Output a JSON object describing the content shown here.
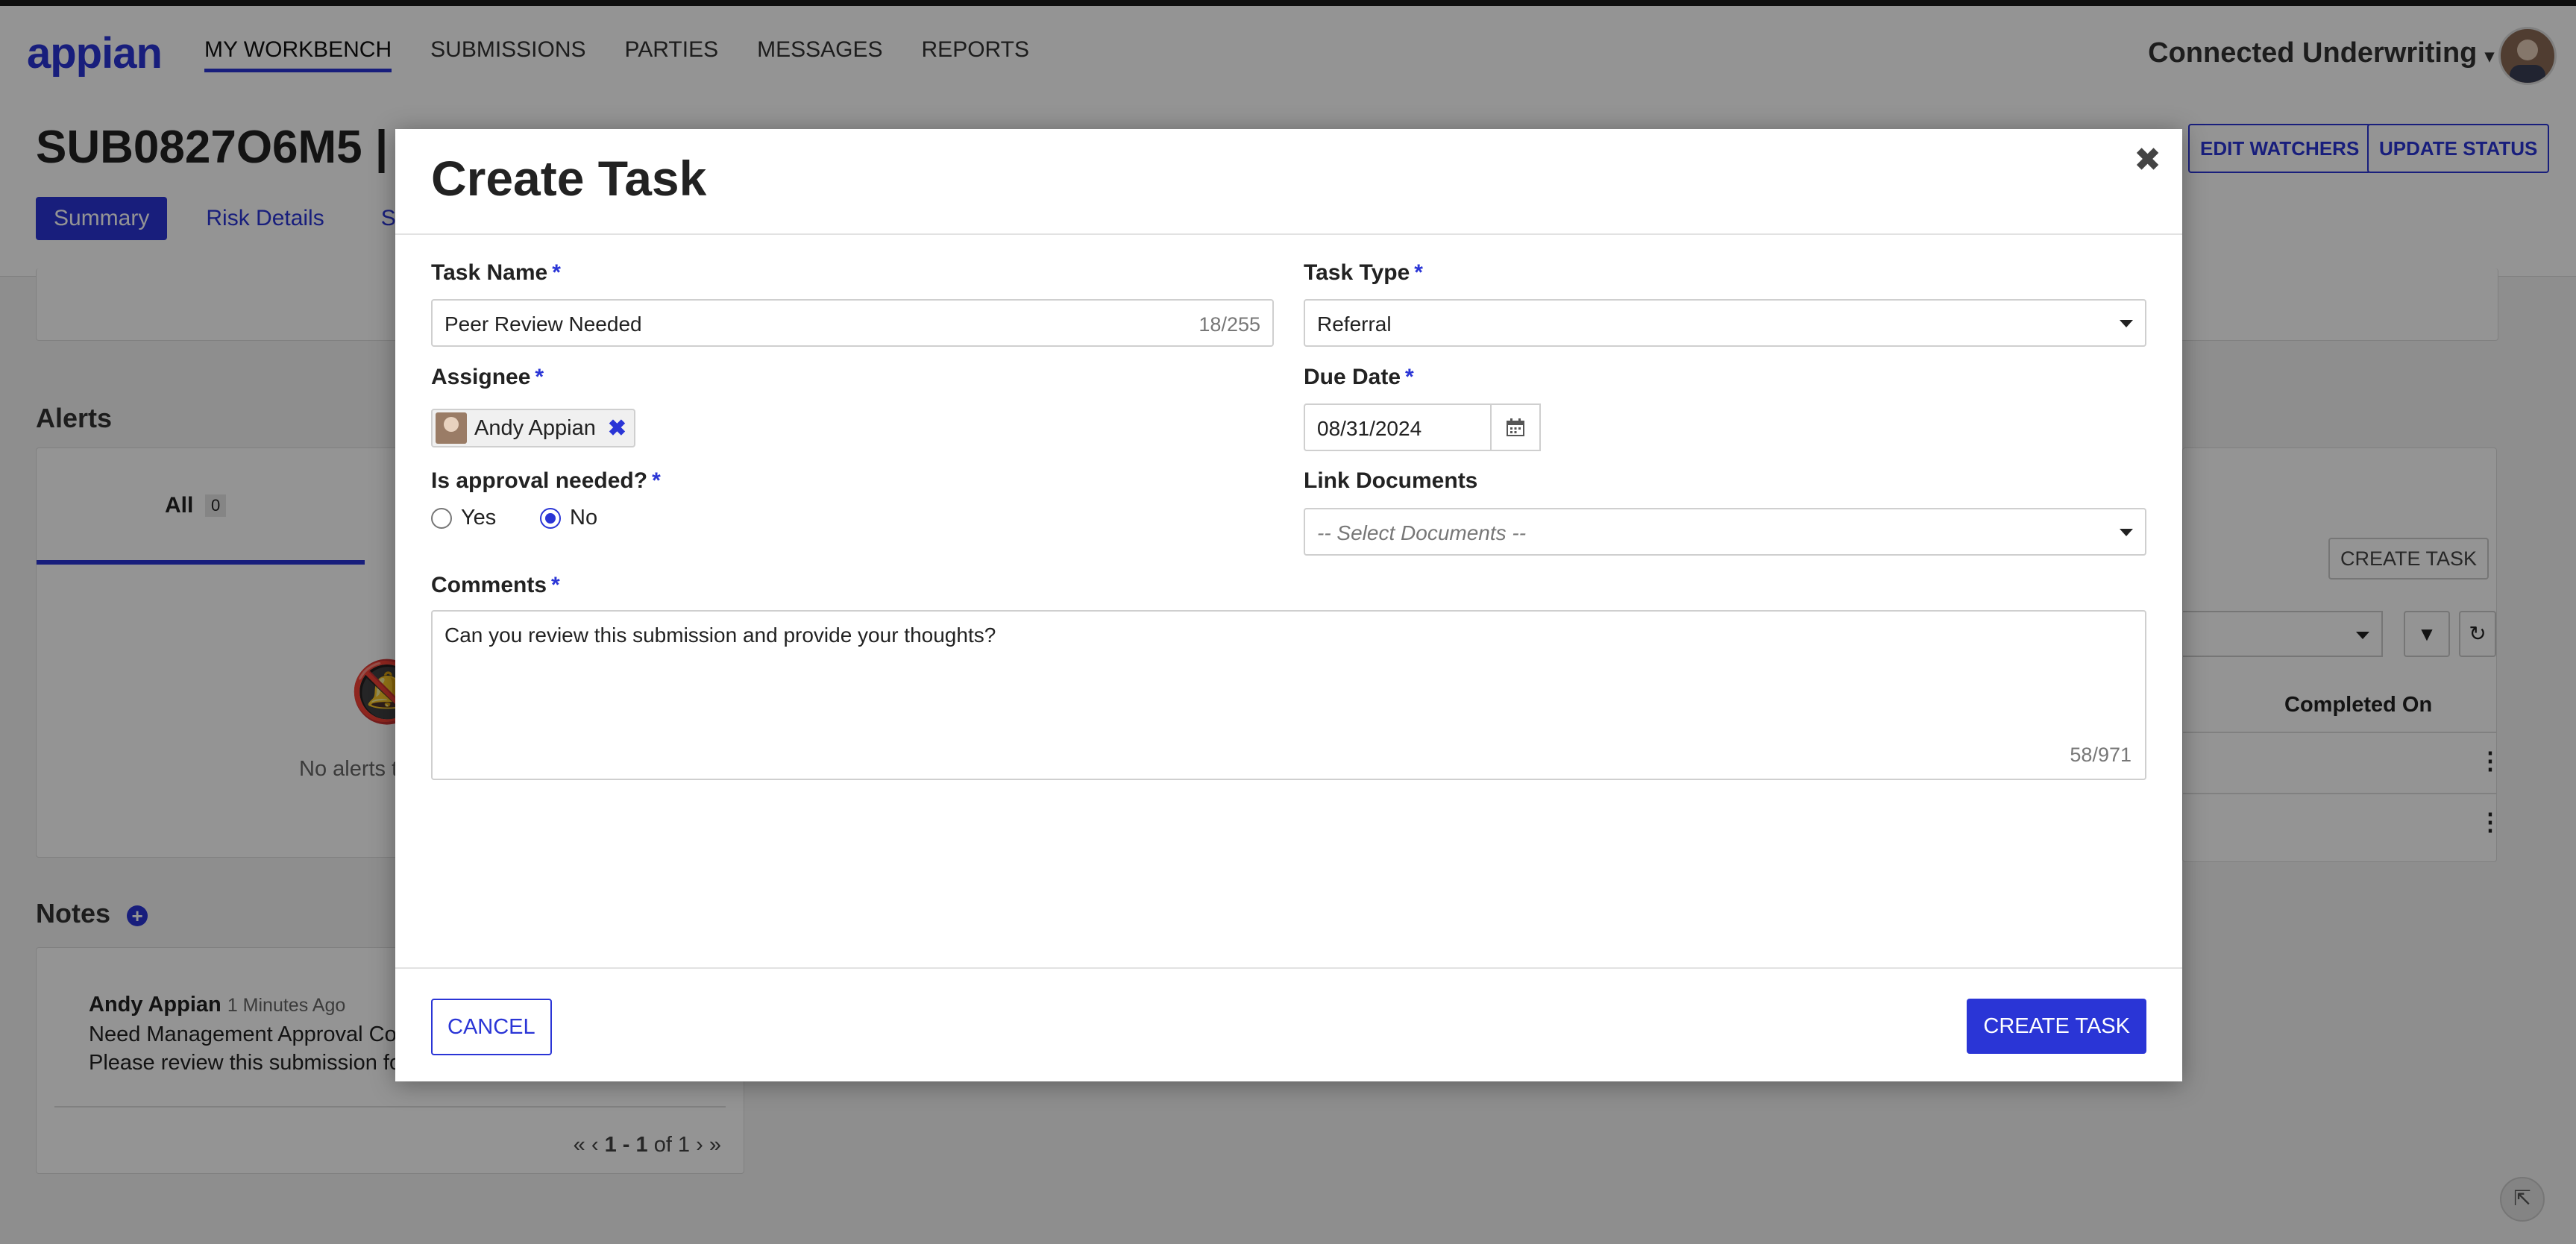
{
  "app": {
    "logo": "appian",
    "nav": [
      "MY WORKBENCH",
      "SUBMISSIONS",
      "PARTIES",
      "MESSAGES",
      "REPORTS"
    ],
    "tenant": "Connected Underwriting"
  },
  "record": {
    "title": "SUB0827O6M5 |",
    "tabs": [
      "Summary",
      "Risk Details",
      "Subm"
    ],
    "edit_watchers": "EDIT WATCHERS",
    "update_status": "UPDATE STATUS"
  },
  "alerts": {
    "title": "Alerts",
    "tab_all": "All",
    "tab_all_count": "0",
    "empty_text": "No alerts t"
  },
  "notes": {
    "title": "Notes",
    "author": "Andy Appian",
    "time": "1 Minutes Ago",
    "line1": "Need Management Approval Co",
    "line2": "Please review this submission fo",
    "pager_range": "1 - 1",
    "pager_of": "of 1"
  },
  "tasks_panel": {
    "create_task": "CREATE TASK",
    "col_completed": "Completed On"
  },
  "modal": {
    "title": "Create Task",
    "task_name": {
      "label": "Task Name",
      "value": "Peer Review Needed",
      "count": "18/255"
    },
    "task_type": {
      "label": "Task Type",
      "value": "Referral"
    },
    "assignee": {
      "label": "Assignee",
      "value": "Andy Appian"
    },
    "due_date": {
      "label": "Due Date",
      "value": "08/31/2024"
    },
    "approval": {
      "label": "Is approval needed?",
      "yes": "Yes",
      "no": "No",
      "selected": "No"
    },
    "link_documents": {
      "label": "Link Documents",
      "placeholder": "-- Select Documents --"
    },
    "comments": {
      "label": "Comments",
      "value": "Can you review this submission and provide your thoughts?",
      "count": "58/971"
    },
    "cancel": "CANCEL",
    "create": "CREATE TASK"
  },
  "colors": {
    "accent": "#2a35d6"
  }
}
